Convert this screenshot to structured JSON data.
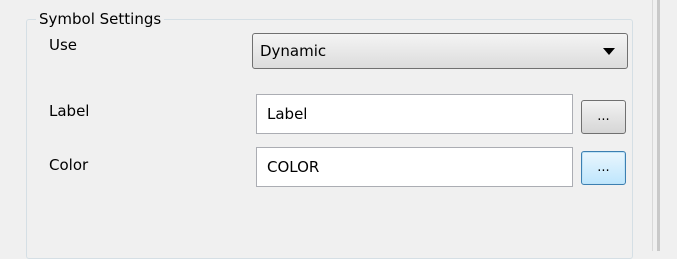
{
  "group": {
    "title": "Symbol Settings"
  },
  "fields": {
    "use": {
      "label": "Use",
      "value": "Dynamic"
    },
    "label": {
      "label": "Label",
      "value": "Label",
      "button": "..."
    },
    "color": {
      "label": "Color",
      "value": "COLOR",
      "button": "..."
    }
  },
  "icons": {
    "dropdown": "chevron-down-icon"
  }
}
